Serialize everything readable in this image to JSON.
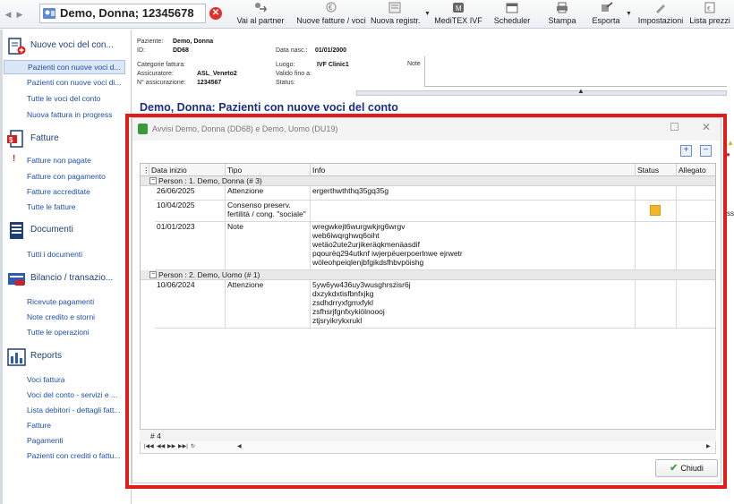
{
  "toolbar": {
    "patient": "Demo, Donna; 12345678",
    "buttons": [
      {
        "label": "Vai al partner"
      },
      {
        "label": "Nuove fatture / voci"
      },
      {
        "label": "Nuova registr."
      },
      {
        "label": "MediTEX IVF"
      },
      {
        "label": "Scheduler"
      },
      {
        "label": "Stampa"
      },
      {
        "label": "Esporta"
      },
      {
        "label": "Impostazioni"
      },
      {
        "label": "Lista prezzi"
      }
    ]
  },
  "sidebar": {
    "sections": [
      {
        "title": "Nuove voci del con...",
        "icon": "add-document-icon",
        "items": [
          "Pazienti con nuove voci d...",
          "Pazienti con nuove voci di...",
          "Tutte le voci del conto",
          "Nuova fattura in progress"
        ]
      },
      {
        "title": "Fatture",
        "icon": "invoice-icon",
        "items": [
          "Fatture non pagate",
          "Fatture con pagamento",
          "Fatture accreditate",
          "Tutte le fatture"
        ]
      },
      {
        "title": "Documenti",
        "icon": "document-icon",
        "items": [
          "Tutti i documenti"
        ]
      },
      {
        "title": "Bilancio / transazio...",
        "icon": "transaction-icon",
        "items": [
          "Ricevute pagamenti",
          "Note credito e storni",
          "Tutte le operazioni"
        ]
      },
      {
        "title": "Reports",
        "icon": "report-icon",
        "items": [
          "Voci fattura",
          "Voci del conto - servizi e ...",
          "Lista debitori - dettagli fatt...",
          "Fatture",
          "Pagamenti",
          "Pazienti con crediti o fattu..."
        ]
      }
    ]
  },
  "header": {
    "paziente_label": "Paziente:",
    "paziente": "Demo, Donna",
    "id_label": "ID:",
    "id": "DD68",
    "data_nasc_label": "Data nasc.:",
    "data_nasc": "01/01/2000",
    "categorie_label": "Categorie fattura:",
    "assicuratore_label": "Assicuratore:",
    "assicuratore": "ASL_Veneto2",
    "n_assic_label": "N° assicurazione:",
    "n_assic": "1234567",
    "luogo_label": "Luogo:",
    "luogo": "IVF Clinic1",
    "valido_label": "Valido fino a:",
    "status_label": "Status:",
    "note_label": "Note"
  },
  "main_title": "Demo, Donna:   Pazienti con nuove voci del conto",
  "dialog": {
    "title": "Avvisi  Demo, Donna (DD68) e Demo, Uomo (DU19)",
    "columns": [
      "Data inizio",
      "Tipo",
      "Info",
      "Status",
      "Allegato"
    ],
    "groups": [
      {
        "label": "Person : 1. Demo, Donna (# 3)",
        "rows": [
          {
            "date": "26/06/2025",
            "type": "Attenzione",
            "info": "ergerthwththq35gq35g",
            "flag": false
          },
          {
            "date": "10/04/2025",
            "type": "Consenso preserv. fertilità / cong. \"sociale\"",
            "info": "",
            "flag": true
          },
          {
            "date": "01/01/2023",
            "type": "Note",
            "info": "wregwkejt6wurgwkjrg6wrgv\nweb6iwqrghwq6oiht\nwetäo2ute2urjikeräqkmenäasdif\npqourëq294utknf iwjerpëuerpoerlnwe ejrwetr\nwöleohpeiqlenjbfgikdsfhbvpöishg",
            "flag": false
          }
        ]
      },
      {
        "label": "Person : 2. Demo, Uomo (# 1)",
        "rows": [
          {
            "date": "10/06/2024",
            "type": "Attenzione",
            "info": "5yw6yw436uy3wusghrszisr6j\ndxzykdxtisfbnfxjkg\nzsdhdrryxfgmxfykl\nzsfhsrjfgnfxykiölnoooj\nztjsryikrykxrukl",
            "flag": false
          }
        ]
      }
    ],
    "count": "# 4",
    "close_label": "Chiudi"
  }
}
